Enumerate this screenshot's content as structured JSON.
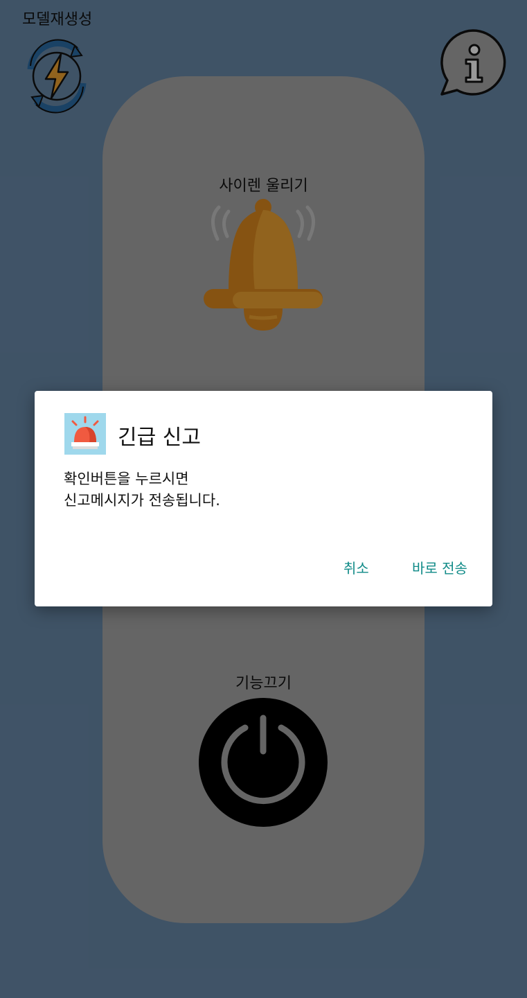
{
  "header": {
    "regen_label": "모델재생성"
  },
  "main": {
    "siren_label": "사이렌 울리기",
    "power_label": "기능끄기"
  },
  "dialog": {
    "title": "긴급 신고",
    "message_line1": "확인버튼을 누르시면",
    "message_line2": "신고메시지가 전송됩니다.",
    "cancel_label": "취소",
    "send_label": "바로 전송"
  },
  "colors": {
    "background": "#6a8bab",
    "panel": "#a8a8a8",
    "accent": "#0f8a87",
    "bell": "#f2a533"
  },
  "icons": {
    "regen": "lightning-refresh-icon",
    "info": "info-chat-icon",
    "bell": "ringing-bell-icon",
    "power": "power-icon",
    "siren": "siren-icon"
  }
}
